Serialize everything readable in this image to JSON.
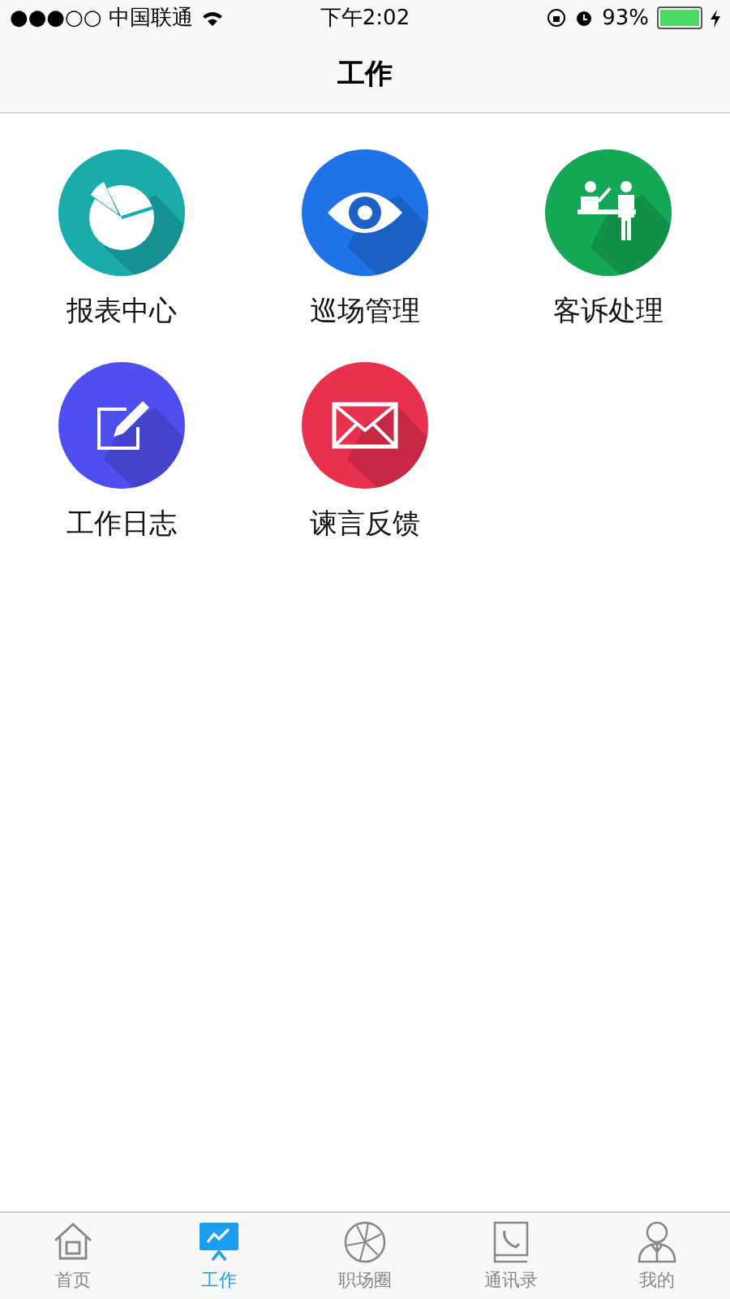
{
  "status_bar": {
    "carrier": "●●●○○ 中国联通",
    "time": "下午2:02",
    "battery_percent": "93%"
  },
  "nav_bar": {
    "title": "工作"
  },
  "apps": [
    {
      "kind": "chart",
      "label": "报表中心",
      "color": "#1aabab"
    },
    {
      "kind": "eye",
      "label": "巡场管理",
      "color": "#1f73e6"
    },
    {
      "kind": "service",
      "label": "客诉处理",
      "color": "#14a755"
    },
    {
      "kind": "edit",
      "label": "工作日志",
      "color": "#4f4ff0"
    },
    {
      "kind": "mail",
      "label": "谏言反馈",
      "color": "#e8304f"
    }
  ],
  "tab_bar": [
    {
      "kind": "home",
      "label": "首页",
      "selected": false
    },
    {
      "kind": "work",
      "label": "工作",
      "selected": true
    },
    {
      "kind": "circle",
      "label": "职场圈",
      "selected": false
    },
    {
      "kind": "contacts",
      "label": "通讯录",
      "selected": false
    },
    {
      "kind": "me",
      "label": "我的",
      "selected": false
    }
  ]
}
